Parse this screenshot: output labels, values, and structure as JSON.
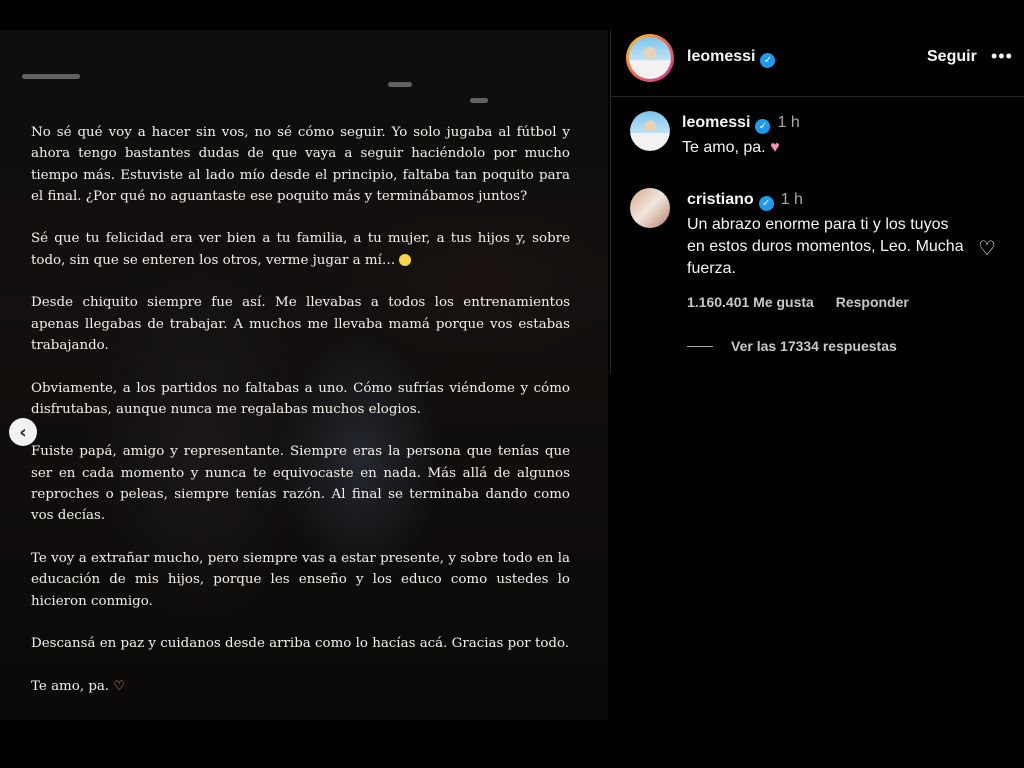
{
  "post": {
    "letter_paragraphs": [
      "No sé qué voy a hacer sin vos, no sé cómo seguir. Yo solo jugaba al fútbol y ahora tengo bastantes dudas de que vaya a seguir haciéndolo por mucho tiempo más. Estuviste al lado mío desde el principio, faltaba tan poquito para el final. ¿Por qué no aguantaste ese poquito más y terminábamos juntos?",
      "Sé que tu felicidad era ver bien a tu familia, a tu mujer, a tus hijos y, sobre todo, sin que se enteren los otros, verme jugar a mí…",
      "Desde chiquito siempre fue así. Me llevabas a todos los entrenamientos apenas llegabas de trabajar. A muchos me llevaba mamá porque vos estabas trabajando.",
      "Obviamente, a los partidos no faltabas a uno. Cómo sufrías viéndome y cómo disfrutabas, aunque nunca me regalabas muchos elogios.",
      "Fuiste papá, amigo y representante. Siempre eras la persona que tenías que ser en cada momento y nunca te equivocaste en nada. Más allá de algunos reproches o peleas, siempre tenías razón. Al final se terminaba dando como vos decías.",
      "Te voy a extrañar mucho, pero siempre vas a estar presente, y sobre todo en la educación de mis hijos, porque les enseño y los educo como ustedes lo hicieron conmigo.",
      "Descansá en paz y cuidanos desde arriba como lo hacías acá. Gracias por todo.",
      "Te amo, pa."
    ],
    "emoji_after_p2": "smiling-face",
    "emoji_after_p8": "♡",
    "prev_icon": "‹"
  },
  "header": {
    "username": "leomessi",
    "verified_icon": "✓",
    "follow_label": "Seguir",
    "more_icon": "•••"
  },
  "comments": [
    {
      "username": "leomessi",
      "verified_icon": "✓",
      "time": "1 h",
      "text": "Te amo, pa.",
      "emoji": "♥"
    },
    {
      "username": "cristiano",
      "verified_icon": "✓",
      "time": "1 h",
      "text": "Un abrazo enorme para ti y los tuyos en estos duros momentos, Leo. Mucha fuerza.",
      "likes": "1.160.401 Me gusta",
      "reply_label": "Responder",
      "view_replies": "Ver las 17334 respuestas",
      "like_icon": "♡"
    }
  ],
  "colors": {
    "verified": "#1d9bf0",
    "background": "#000000",
    "divider": "#262626",
    "muted_text": "#a8a8a8"
  }
}
